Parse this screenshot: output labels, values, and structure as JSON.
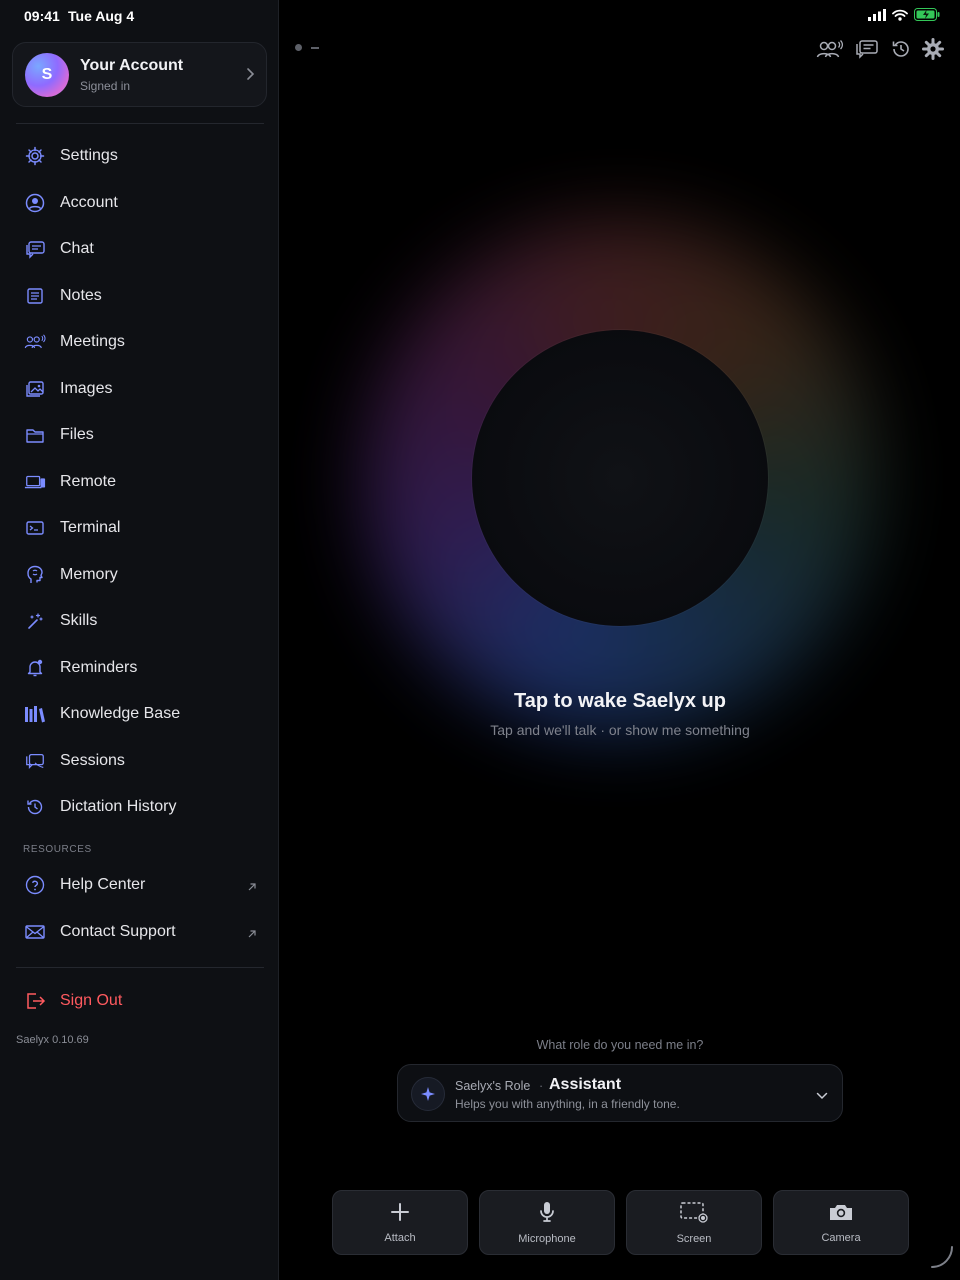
{
  "status_bar": {
    "time": "09:41",
    "date": "Tue Aug 4"
  },
  "account": {
    "initial": "S",
    "name": "Your Account",
    "status": "Signed in"
  },
  "nav": [
    {
      "label": "Settings",
      "icon": "gear-icon"
    },
    {
      "label": "Account",
      "icon": "user-circle-icon"
    },
    {
      "label": "Chat",
      "icon": "chat-bubbles-icon"
    },
    {
      "label": "Notes",
      "icon": "notes-icon"
    },
    {
      "label": "Meetings",
      "icon": "meetings-icon"
    },
    {
      "label": "Images",
      "icon": "images-icon"
    },
    {
      "label": "Files",
      "icon": "folder-icon"
    },
    {
      "label": "Remote",
      "icon": "remote-icon"
    },
    {
      "label": "Terminal",
      "icon": "terminal-icon"
    },
    {
      "label": "Memory",
      "icon": "memory-head-icon"
    },
    {
      "label": "Skills",
      "icon": "wand-icon"
    },
    {
      "label": "Reminders",
      "icon": "bell-icon"
    },
    {
      "label": "Knowledge Base",
      "icon": "books-icon"
    },
    {
      "label": "Sessions",
      "icon": "sessions-icon"
    },
    {
      "label": "Dictation History",
      "icon": "history-icon"
    }
  ],
  "resources": {
    "heading": "RESOURCES",
    "items": [
      {
        "label": "Help Center",
        "icon": "help-icon"
      },
      {
        "label": "Contact Support",
        "icon": "mail-icon"
      }
    ]
  },
  "sign_out": {
    "label": "Sign Out"
  },
  "version": "Saelyx 0.10.69",
  "main": {
    "title": "Tap to wake Saelyx up",
    "subtitle": "Tap and we'll talk · or show me something",
    "role_question": "What role do you need me in?",
    "role": {
      "label": "Saelyx's Role",
      "separator": "·",
      "name": "Assistant",
      "description": "Helps you with anything, in a friendly tone."
    },
    "actions": [
      {
        "label": "Attach",
        "icon": "plus-icon"
      },
      {
        "label": "Microphone",
        "icon": "microphone-icon"
      },
      {
        "label": "Screen",
        "icon": "screen-record-icon"
      },
      {
        "label": "Camera",
        "icon": "camera-icon"
      }
    ]
  },
  "colors": {
    "accent": "#7b8cff",
    "danger": "#ff5a5f",
    "sidebar_bg": "#0e1014"
  }
}
